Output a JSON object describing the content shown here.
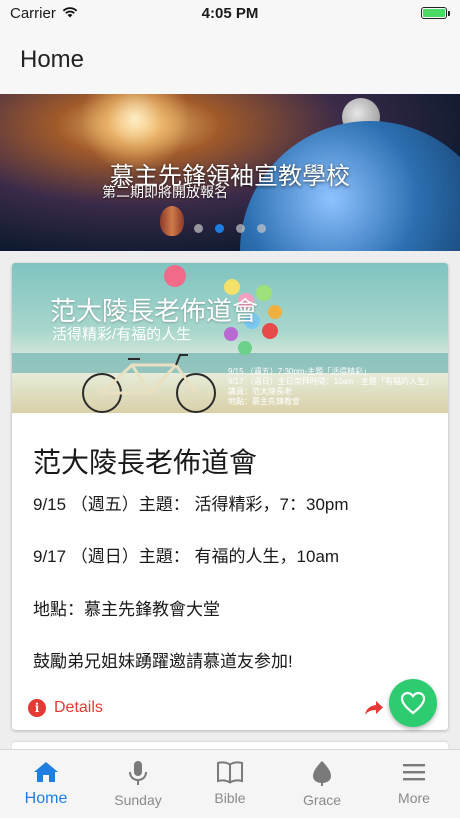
{
  "status_bar": {
    "carrier": "Carrier",
    "time": "4:05 PM",
    "battery_level": 1.0,
    "icons": [
      "wifi-icon",
      "battery-icon"
    ]
  },
  "header": {
    "title": "Home"
  },
  "banner": {
    "title": "慕主先鋒領袖宣教學校",
    "subtitle": "第二期即將開放報名",
    "page_count": 4,
    "active_page": 2
  },
  "card": {
    "image": {
      "title": "范大陵長老佈道會",
      "subtitle": "活得精彩/有福的人生",
      "info_lines": [
        "9/15 （週五）7:30pm-主題「活得精彩」",
        "9/17 （週日）主日崇拜時間：10am - 主題「有福的人生」",
        "講員：范大陵長老",
        "地點：慕主先鋒教會"
      ]
    },
    "title": "范大陵長老佈道會",
    "lines": [
      "9/15 （週五）主題： 活得精彩，7：30pm",
      "9/17 （週日）主題： 有福的人生，10am",
      "地點：慕主先鋒教會大堂",
      "鼓勵弟兄姐妹踴躍邀請慕道友参加!"
    ],
    "details_label": "Details",
    "icons": [
      "info-icon",
      "share-icon"
    ]
  },
  "fab": {
    "icon": "heart-icon"
  },
  "tab_bar": {
    "tabs": [
      {
        "label": "Home",
        "icon": "home-icon",
        "active": true
      },
      {
        "label": "Sunday",
        "icon": "microphone-icon",
        "active": false
      },
      {
        "label": "Bible",
        "icon": "book-icon",
        "active": false
      },
      {
        "label": "Grace",
        "icon": "leaf-icon",
        "active": false
      },
      {
        "label": "More",
        "icon": "menu-icon",
        "active": false
      }
    ]
  },
  "colors": {
    "accent": "#1e7fe0",
    "details": "#e53935",
    "fab": "#2ecc71",
    "battery": "#4cd964"
  }
}
